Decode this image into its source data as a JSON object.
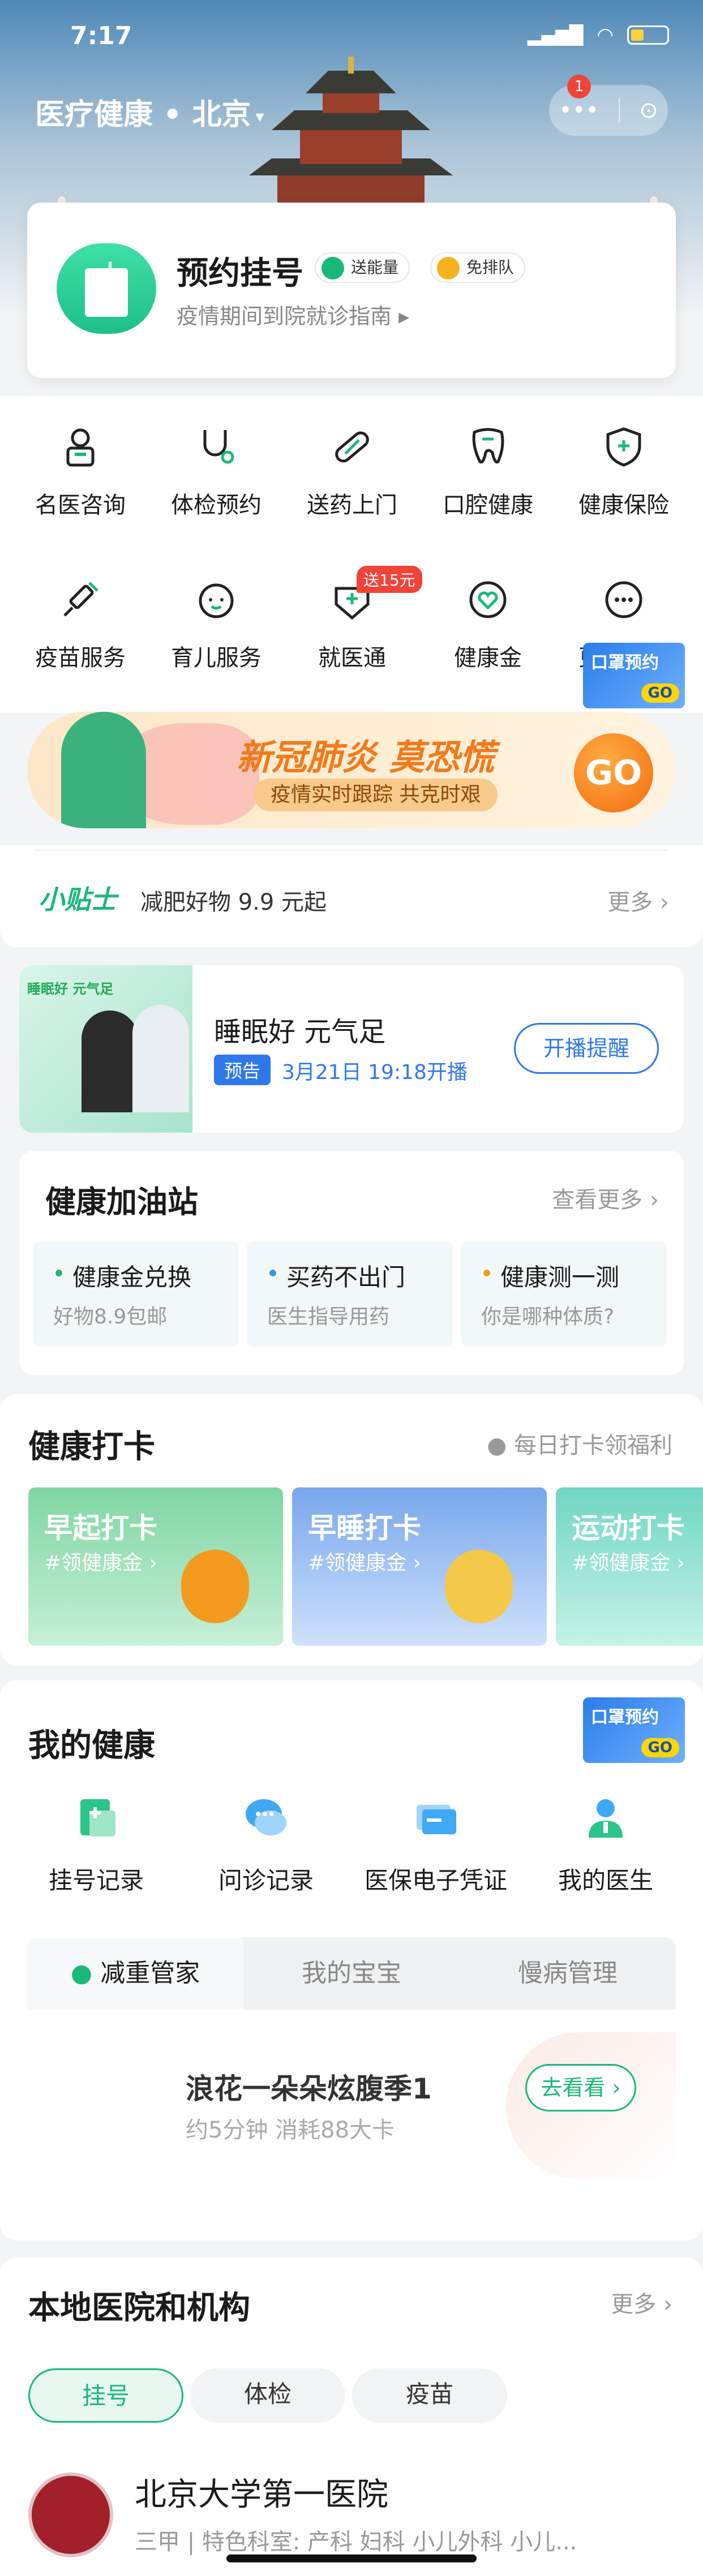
{
  "status_bar": {
    "time": "7:17"
  },
  "header": {
    "title": "医疗健康 • 北京",
    "caret": "▾",
    "message_count": "1",
    "more_icon": "•••",
    "close_icon": "⊙"
  },
  "appointment": {
    "title": "预约挂号",
    "tag1": "送能量",
    "tag2": "免排队",
    "subtitle": "疫情期间到院就诊指南 ▸"
  },
  "services": [
    {
      "label": "名医咨询",
      "icon": "doctor-icon"
    },
    {
      "label": "体检预约",
      "icon": "stethoscope-icon"
    },
    {
      "label": "送药上门",
      "icon": "pill-icon"
    },
    {
      "label": "口腔健康",
      "icon": "tooth-icon"
    },
    {
      "label": "健康保险",
      "icon": "shield-icon"
    },
    {
      "label": "疫苗服务",
      "icon": "syringe-icon"
    },
    {
      "label": "育儿服务",
      "icon": "baby-icon"
    },
    {
      "label": "就医通",
      "icon": "medical-tag-icon"
    },
    {
      "label": "健康金",
      "icon": "heart-coin-icon"
    },
    {
      "label": "更多服务",
      "icon": "more-icon"
    }
  ],
  "service_badge": "送15元",
  "mask_promo": {
    "label": "口罩预约",
    "go": "GO"
  },
  "banner": {
    "headline": "新冠肺炎 莫恐慌",
    "pill": "疫情实时跟踪 共克时艰",
    "go": "GO"
  },
  "tips": {
    "logo": "小贴士",
    "text": "减肥好物 9.9 元起",
    "more": "更多 ›"
  },
  "live": {
    "thumb_title": "睡眠好 元气足",
    "title": "睡眠好 元气足",
    "pre_label": "预告",
    "when": "3月21日 19:18开播",
    "remind": "开播提醒"
  },
  "station": {
    "title": "健康加油站",
    "more": "查看更多 ›",
    "cards": [
      {
        "title": "健康金兑换",
        "sub": "好物8.9包邮",
        "dot": "#1ab879"
      },
      {
        "title": "买药不出门",
        "sub": "医生指导用药",
        "dot": "#2f9be4"
      },
      {
        "title": "健康测一测",
        "sub": "你是哪种体质?",
        "dot": "#f49a1f"
      }
    ]
  },
  "checkin": {
    "title": "健康打卡",
    "hint": "● 每日打卡领福利",
    "cards": [
      {
        "title": "早起打卡",
        "sub": "#领健康金 ›"
      },
      {
        "title": "早睡打卡",
        "sub": "#领健康金 ›"
      },
      {
        "title": "运动打卡",
        "sub": "#领健康金 ›"
      }
    ]
  },
  "my_health": {
    "title": "我的健康",
    "items": [
      {
        "label": "挂号记录",
        "icon": "register-record-icon"
      },
      {
        "label": "问诊记录",
        "icon": "chat-record-icon"
      },
      {
        "label": "医保电子凭证",
        "icon": "insurance-card-icon"
      },
      {
        "label": "我的医生",
        "icon": "my-doctor-icon"
      }
    ],
    "tabs": [
      "减重管家",
      "我的宝宝",
      "慢病管理"
    ],
    "panel": {
      "title": "浪花一朵朵炫腹季1",
      "sub": "约5分钟 消耗88大卡",
      "button": "去看看 ›"
    }
  },
  "local": {
    "title": "本地医院和机构",
    "more": "更多 ›",
    "chips": [
      "挂号",
      "体检",
      "疫苗"
    ],
    "hospital": {
      "name": "北京大学第一医院",
      "meta": "三甲 | 特色科室: 产科 妇科 小儿外科 小儿..."
    }
  },
  "colors": {
    "brand_green": "#1ab879",
    "accent_blue": "#2f78ea",
    "orange": "#f27a1a"
  }
}
